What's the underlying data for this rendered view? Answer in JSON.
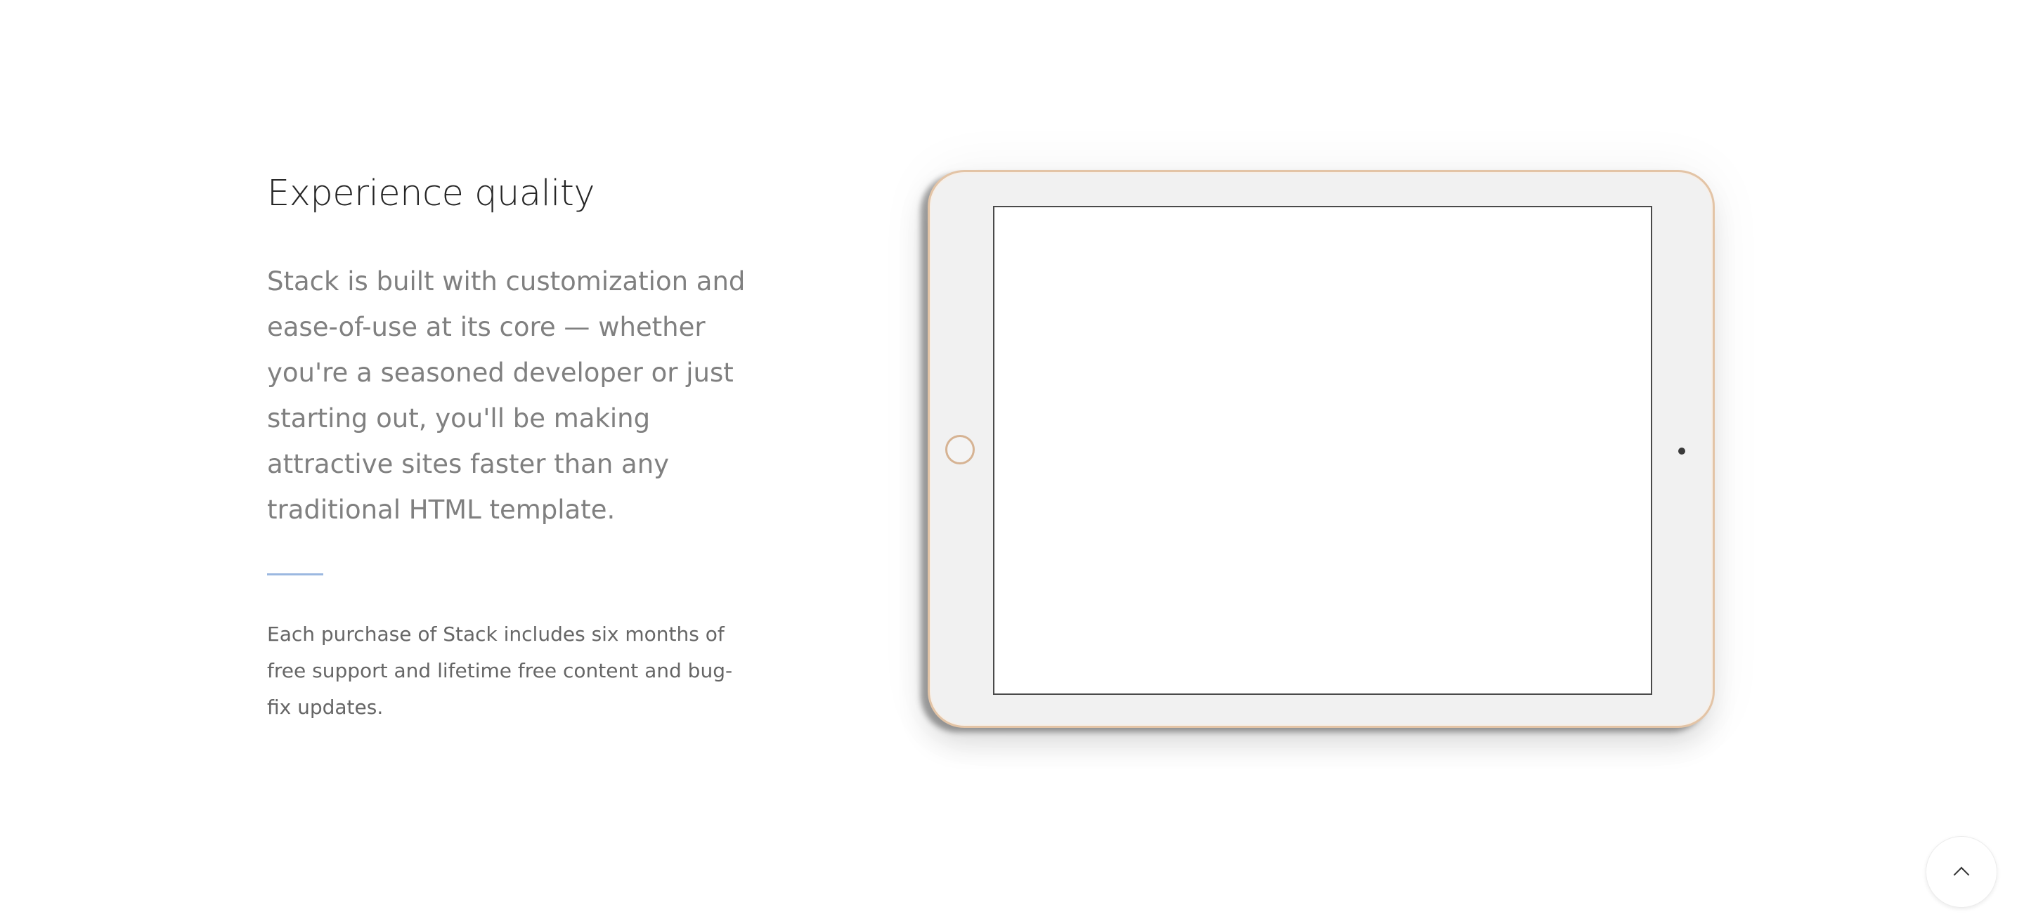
{
  "feature": {
    "heading": "Experience quality",
    "lead": "Stack is built with customization and ease-of-use at its core — whether you're a seasoned developer or just starting out, you'll be making attractive sites faster than any traditional HTML template.",
    "body": "Each purchase of Stack includes six months of free support and lifetime free content and bug-fix updates."
  },
  "device": {
    "type": "tablet",
    "frame_color": "#e3c4a6",
    "body_color": "#f1f1f1"
  },
  "back_to_top": {
    "icon": "chevron-up-icon"
  },
  "colors": {
    "divider_accent": "#9bb8e0",
    "heading_text": "#252525",
    "lead_text": "#808080",
    "body_text": "#666666"
  }
}
